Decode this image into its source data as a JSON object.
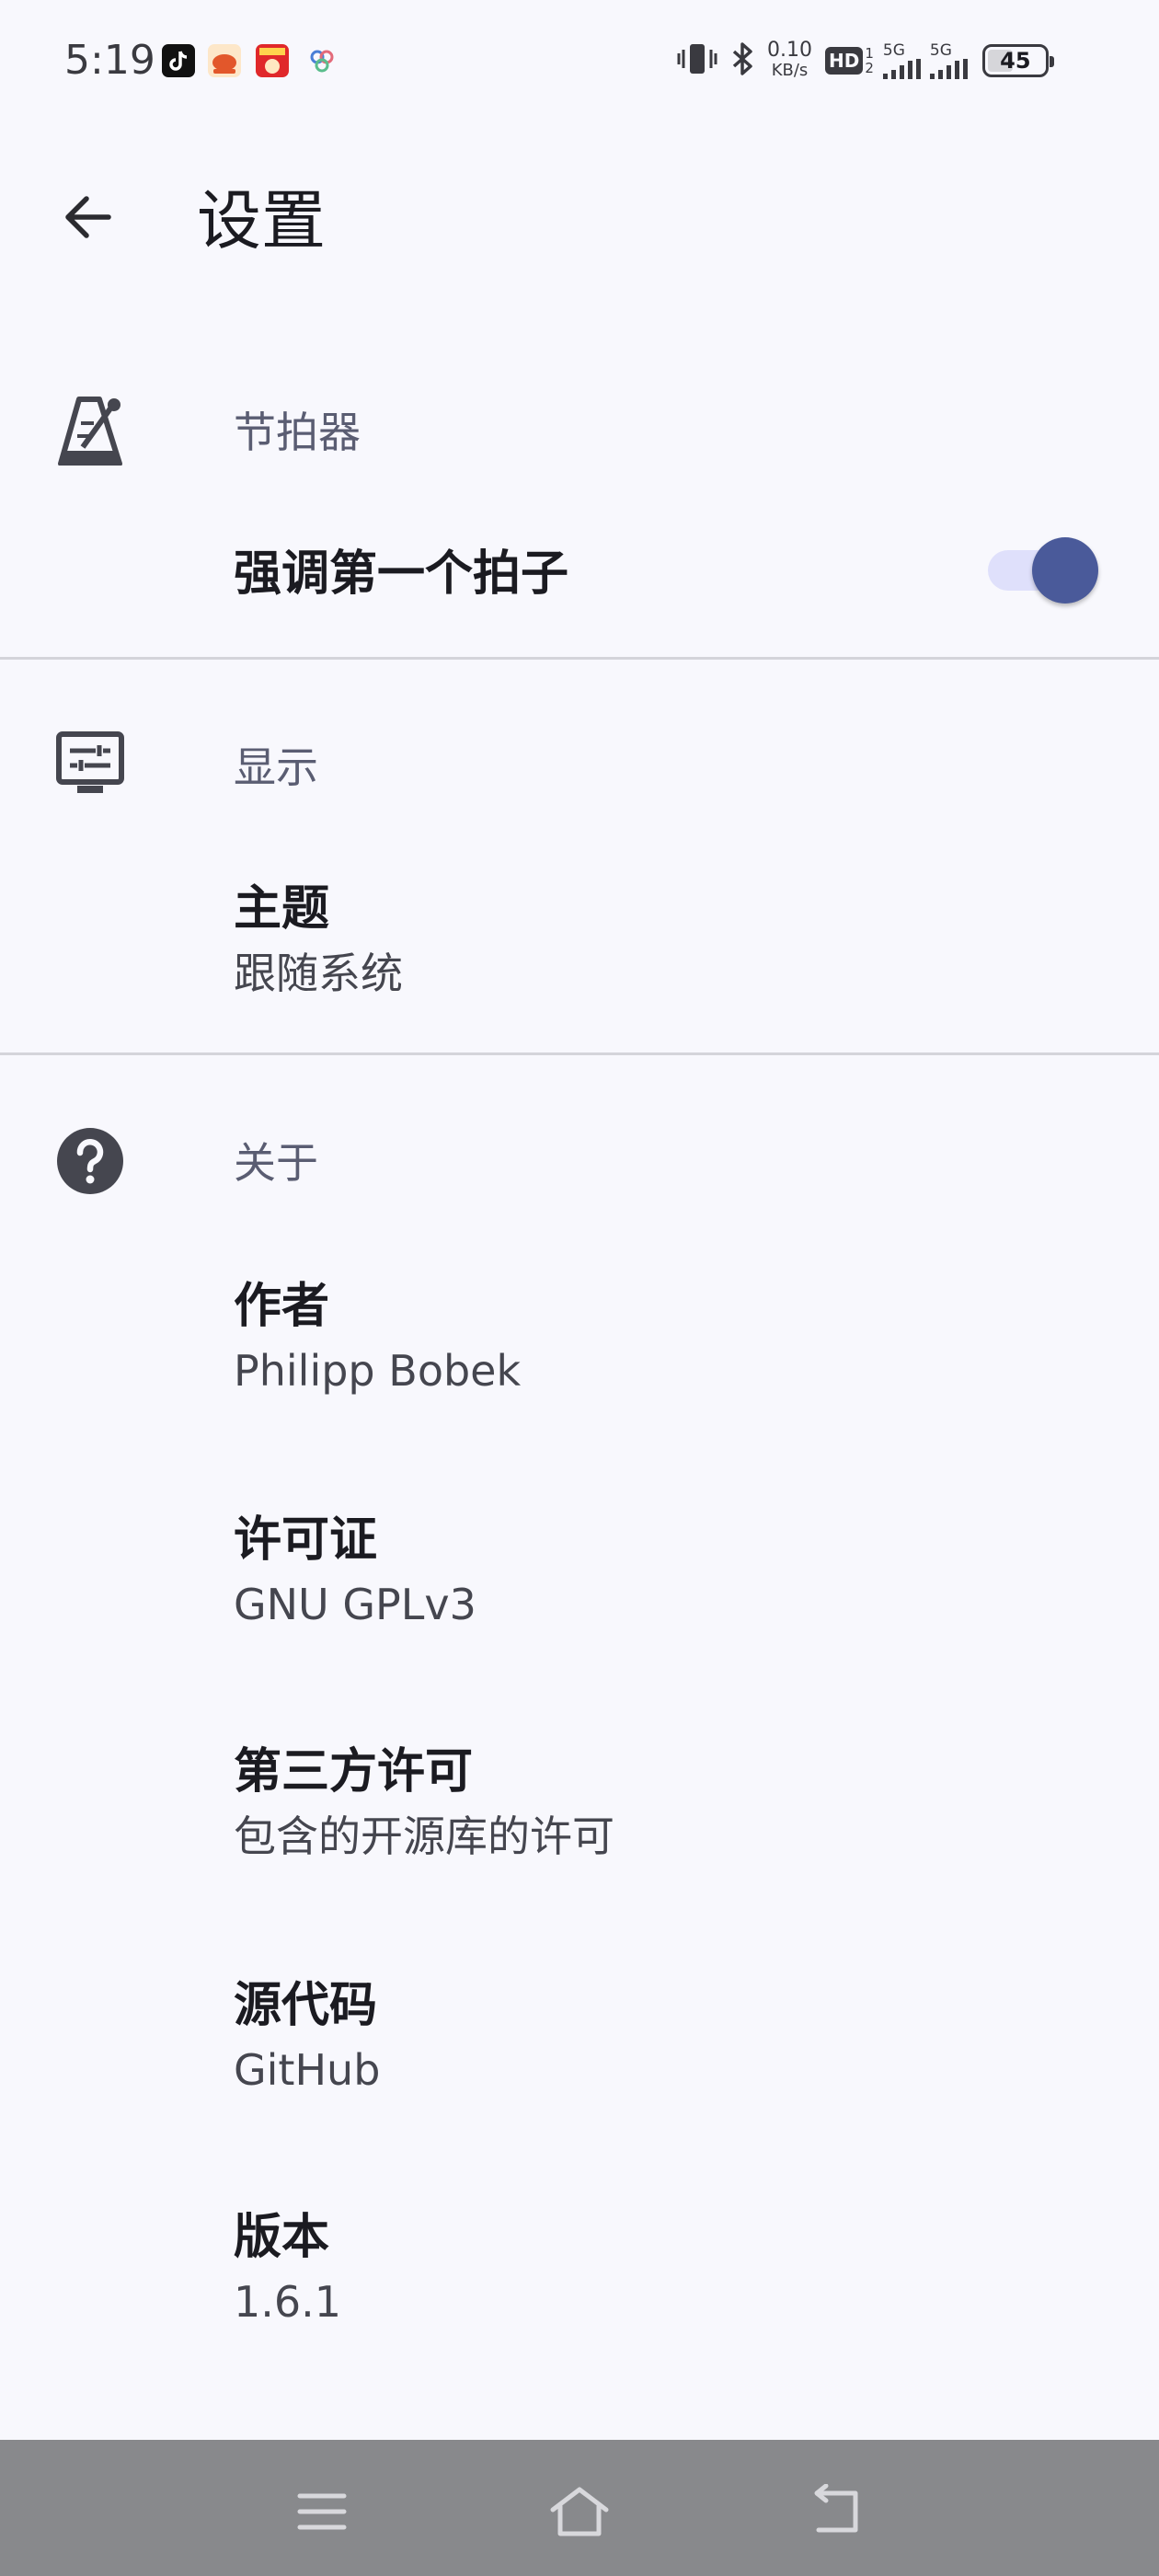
{
  "status_bar": {
    "time": "5:19",
    "net_speed_value": "0.10",
    "net_speed_unit": "KB/s",
    "hd_label": "HD",
    "hd_sub": "1",
    "hd_sub2": "2",
    "signal1_label": "5G",
    "signal2_label": "5G",
    "battery": "45",
    "battery_level": 0.45,
    "notification_icons": [
      "tiktok-icon",
      "food-app-icon",
      "red-app-icon",
      "clover-app-icon"
    ]
  },
  "app_bar": {
    "title": "设置",
    "back_icon": "arrow-left-icon"
  },
  "sections": {
    "metronome": {
      "title": "节拍器",
      "icon": "metronome-icon",
      "accent_first_beat": {
        "label": "强调第一个拍子",
        "enabled": true
      }
    },
    "display": {
      "title": "显示",
      "icon": "display-settings-icon",
      "theme": {
        "title": "主题",
        "value": "跟随系统"
      }
    },
    "about": {
      "title": "关于",
      "icon": "help-circle-icon",
      "author": {
        "title": "作者",
        "value": "Philipp Bobek"
      },
      "license": {
        "title": "许可证",
        "value": "GNU GPLv3"
      },
      "third_party": {
        "title": "第三方许可",
        "value": "包含的开源库的许可"
      },
      "source_code": {
        "title": "源代码",
        "value": "GitHub"
      },
      "version": {
        "title": "版本",
        "value": "1.6.1"
      }
    }
  },
  "nav_bar": {
    "icons": [
      "menu-icon",
      "home-icon",
      "back-icon"
    ]
  },
  "colors": {
    "background": "#f8f8fd",
    "accent": "#4a5a9a",
    "switch_track": "#dfe0fb",
    "section_title": "#5a5d72",
    "nav_bar": "#88898c"
  }
}
